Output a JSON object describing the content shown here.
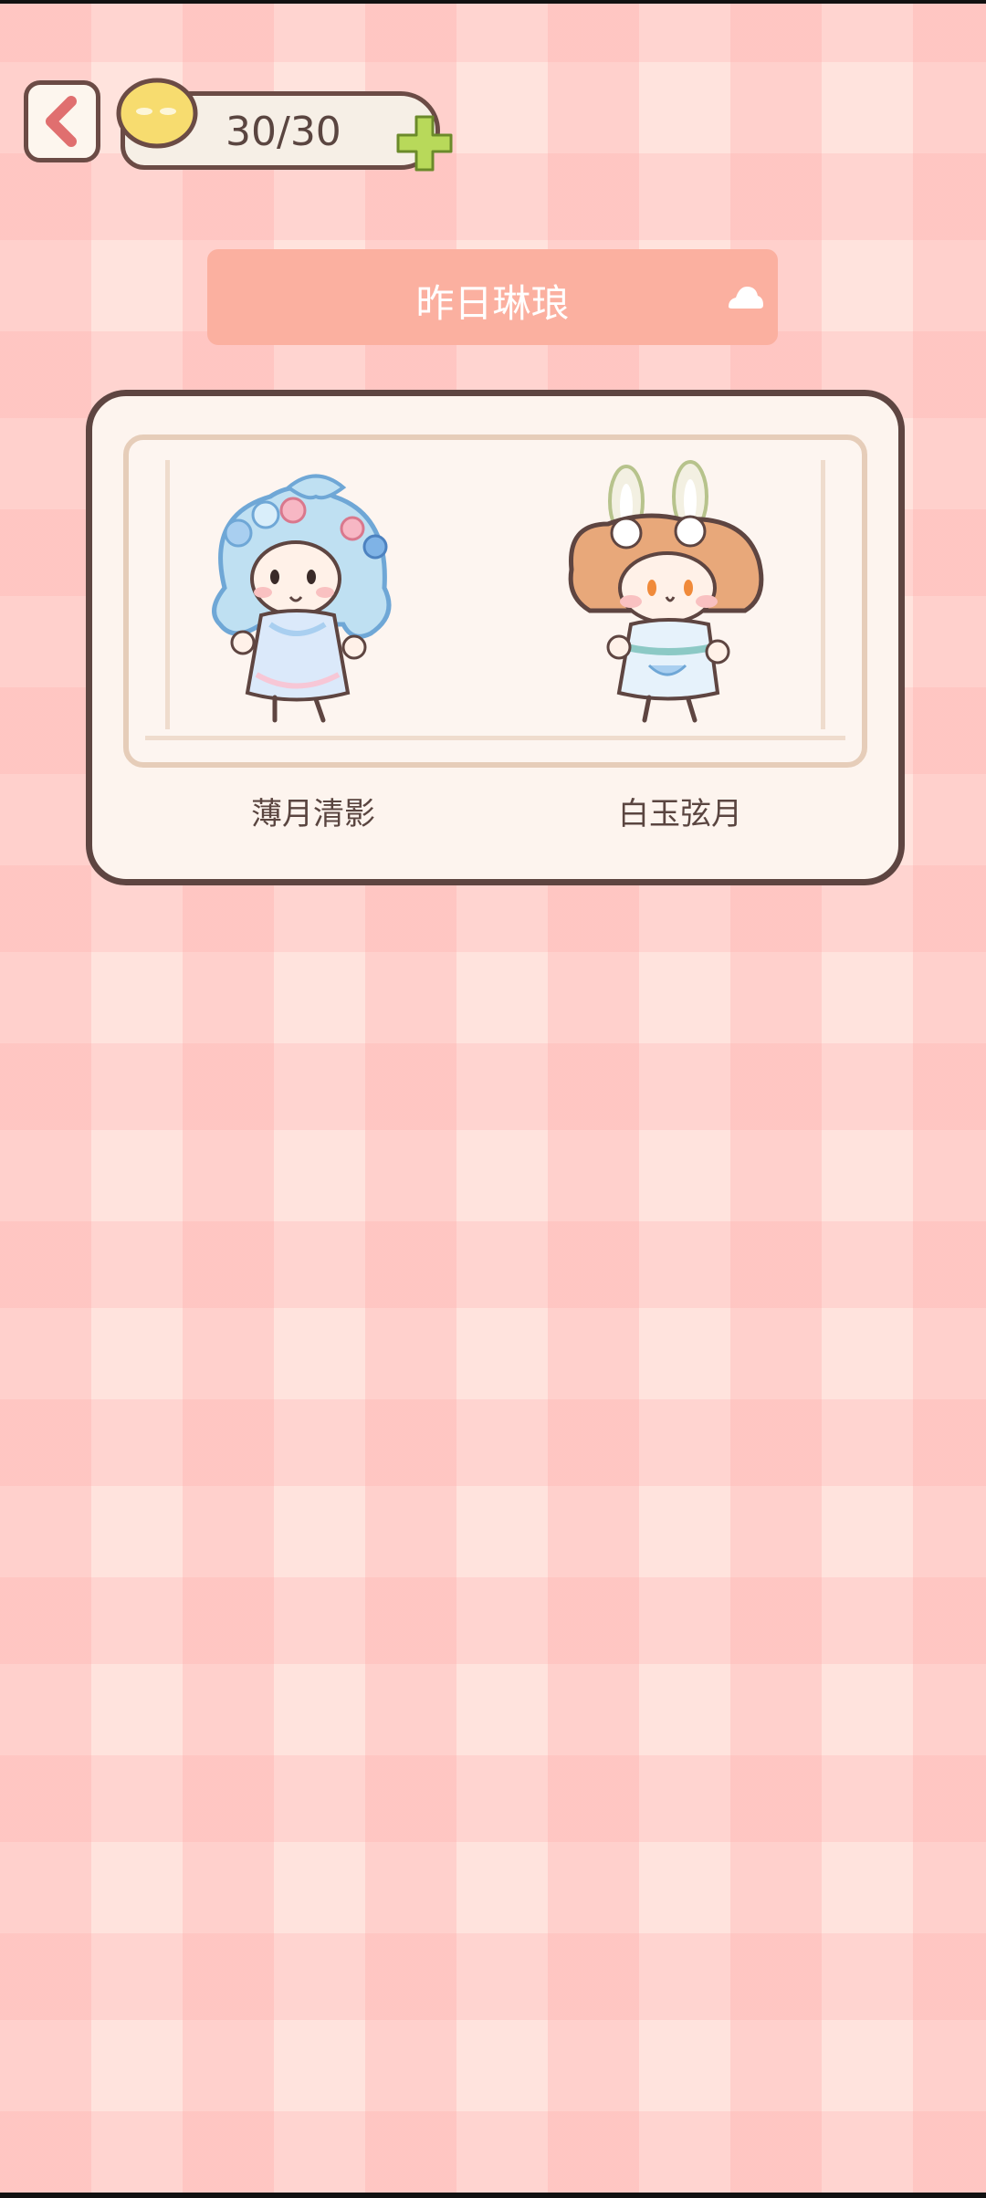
{
  "header": {
    "energy": "30/30",
    "icons": [
      "back-arrow-icon",
      "smiley-face-icon",
      "plus-icon"
    ]
  },
  "dropdown": {
    "selected": "昨日琳琅",
    "icon": "caret-up-icon"
  },
  "outfits": [
    {
      "name": "薄月清影"
    },
    {
      "name": "白玉弦月"
    }
  ],
  "colors": {
    "accent": "#fbb0a0",
    "outline": "#5e4541",
    "plus": "#b8d95a",
    "face": "#f7dc6f"
  }
}
